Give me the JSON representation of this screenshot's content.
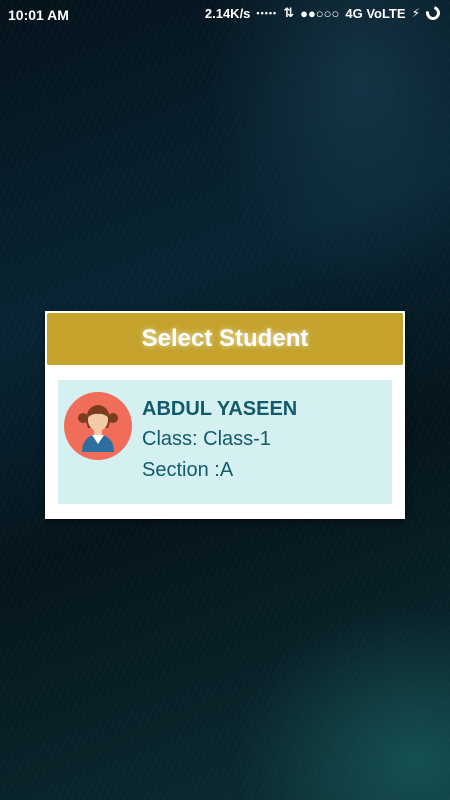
{
  "status_bar": {
    "time": "10:01 AM",
    "speed": "2.14K/s",
    "signal_dots": "•••••",
    "network": "4G VoLTE"
  },
  "dialog": {
    "title": "Select Student",
    "students": [
      {
        "name": "ABDUL YASEEN",
        "class": "Class: Class-1",
        "section": "Section :A",
        "avatar": "girl-student-icon"
      }
    ]
  },
  "colors": {
    "header": "#c4a22c",
    "card": "#d5f0f1",
    "text": "#135a6b",
    "avatar_bg": "#f06d5a"
  }
}
